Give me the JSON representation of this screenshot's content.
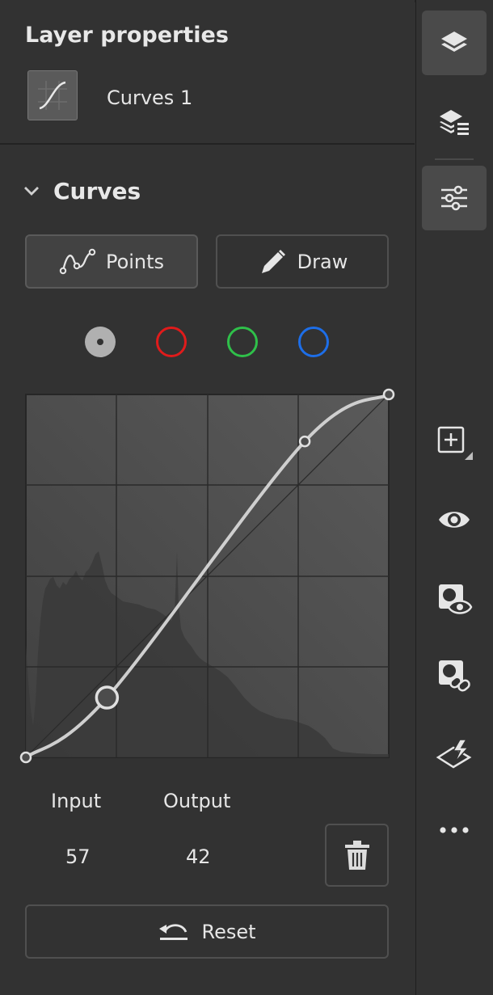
{
  "panel": {
    "title": "Layer properties",
    "layer_name": "Curves 1",
    "layer_thumb_icon": "curves-adjustment-icon"
  },
  "section": {
    "title": "Curves",
    "expanded": true
  },
  "modes": {
    "points_label": "Points",
    "draw_label": "Draw",
    "selected": "points"
  },
  "channels": [
    {
      "name": "RGB",
      "color": "#b0b0b0",
      "selected": true
    },
    {
      "name": "Red",
      "color": "#e01b1b",
      "selected": false
    },
    {
      "name": "Green",
      "color": "#2fc04a",
      "selected": false
    },
    {
      "name": "Blue",
      "color": "#1d6ee8",
      "selected": false
    }
  ],
  "curve": {
    "points": [
      [
        0,
        0
      ],
      [
        57,
        42
      ],
      [
        196,
        222
      ],
      [
        255,
        255
      ]
    ],
    "selected_point": 1,
    "range": [
      0,
      255
    ]
  },
  "io": {
    "input_label": "Input",
    "output_label": "Output",
    "input_value": "57",
    "output_value": "42"
  },
  "reset_label": "Reset",
  "rail": [
    {
      "icon": "layers-icon",
      "active": true
    },
    {
      "icon": "layer-stack-icon",
      "active": false
    },
    {
      "icon": "adjustments-sliders-icon",
      "active": true
    },
    {
      "icon": "add-layer-icon",
      "active": false
    },
    {
      "icon": "visibility-eye-icon",
      "active": false
    },
    {
      "icon": "mask-visibility-icon",
      "active": false
    },
    {
      "icon": "mask-link-icon",
      "active": false
    },
    {
      "icon": "clipping-mask-icon",
      "active": false
    },
    {
      "icon": "more-options-icon",
      "active": false
    }
  ],
  "colors": {
    "background": "#323232",
    "grid_background": "#4a4a4a",
    "curve": "#cfcfcf"
  }
}
